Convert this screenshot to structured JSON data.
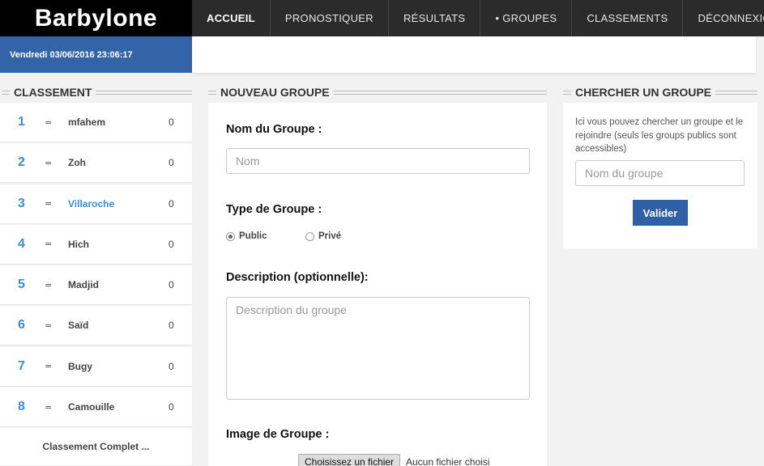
{
  "brand": {
    "logo": "Barbylone"
  },
  "nav": [
    {
      "label": "ACCUEIL",
      "active": true
    },
    {
      "label": "PRONOSTIQUER"
    },
    {
      "label": "RÉSULTATS"
    },
    {
      "label": "GROUPES",
      "bullet": "•"
    },
    {
      "label": "CLASSEMENTS"
    },
    {
      "label": "DÉCONNEXION"
    }
  ],
  "datebar": {
    "text": "Vendredi 03/06/2016 23:06:17"
  },
  "ranking": {
    "title": "CLASSEMENT",
    "rows": [
      {
        "rank": "1",
        "trend": "=",
        "name": "mfahem",
        "points": "0"
      },
      {
        "rank": "2",
        "trend": "=",
        "name": "Zoh",
        "points": "0"
      },
      {
        "rank": "3",
        "trend": "=",
        "name": "Villaroche",
        "points": "0"
      },
      {
        "rank": "4",
        "trend": "=",
        "name": "Hich",
        "points": "0"
      },
      {
        "rank": "5",
        "trend": "=",
        "name": "Madjid",
        "points": "0"
      },
      {
        "rank": "6",
        "trend": "=",
        "name": "Saïd",
        "points": "0"
      },
      {
        "rank": "7",
        "trend": "=",
        "name": "Bugy",
        "points": "0"
      },
      {
        "rank": "8",
        "trend": "=",
        "name": "Camouille",
        "points": "0"
      }
    ],
    "more_label": "Classement Complet ..."
  },
  "new_group": {
    "title": "NOUVEAU GROUPE",
    "name_label": "Nom du Groupe :",
    "name_placeholder": "Nom",
    "type_label": "Type de Groupe :",
    "type_public": "Public",
    "type_private": "Privé",
    "description_label": "Description (optionnelle):",
    "description_placeholder": "Description du groupe",
    "image_label": "Image de Groupe :",
    "file_button": "Choisissez un fichier",
    "file_status": "Aucun fichier choisi"
  },
  "search_group": {
    "title": "CHERCHER UN GROUPE",
    "help": "Ici vous pouvez chercher un groupe et le rejoindre (seuls les groups publics sont accessibles)",
    "placeholder": "Nom du groupe",
    "submit": "Valider"
  },
  "colors": {
    "accent_blue": "#3364a8",
    "rank_blue": "#3a8dde",
    "nav_bg": "#2b2b2b"
  }
}
